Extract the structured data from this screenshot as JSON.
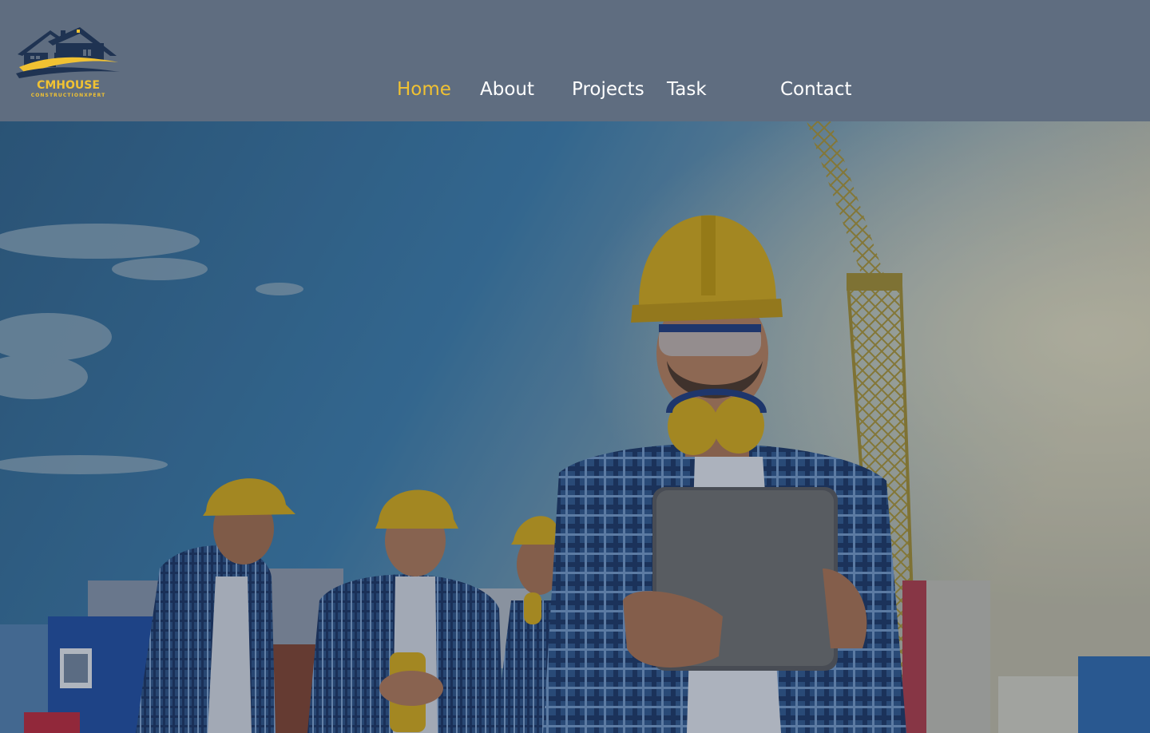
{
  "brand": {
    "name": "CMHOUSE",
    "tagline": "CONSTRUCTIONXPERT"
  },
  "nav": {
    "items": [
      {
        "label": "Home",
        "active": true
      },
      {
        "label": "About",
        "active": false
      },
      {
        "label": "Projects",
        "active": false
      },
      {
        "label": "Task",
        "active": false
      },
      {
        "label": "Contact",
        "active": false
      }
    ]
  },
  "colors": {
    "header_bg": "#5f6d80",
    "accent": "#f1c232",
    "nav_text": "#ffffff",
    "logo_navy": "#1f3352"
  },
  "hero": {
    "image": "construction-workers-hard-hats-tablet-crane"
  }
}
